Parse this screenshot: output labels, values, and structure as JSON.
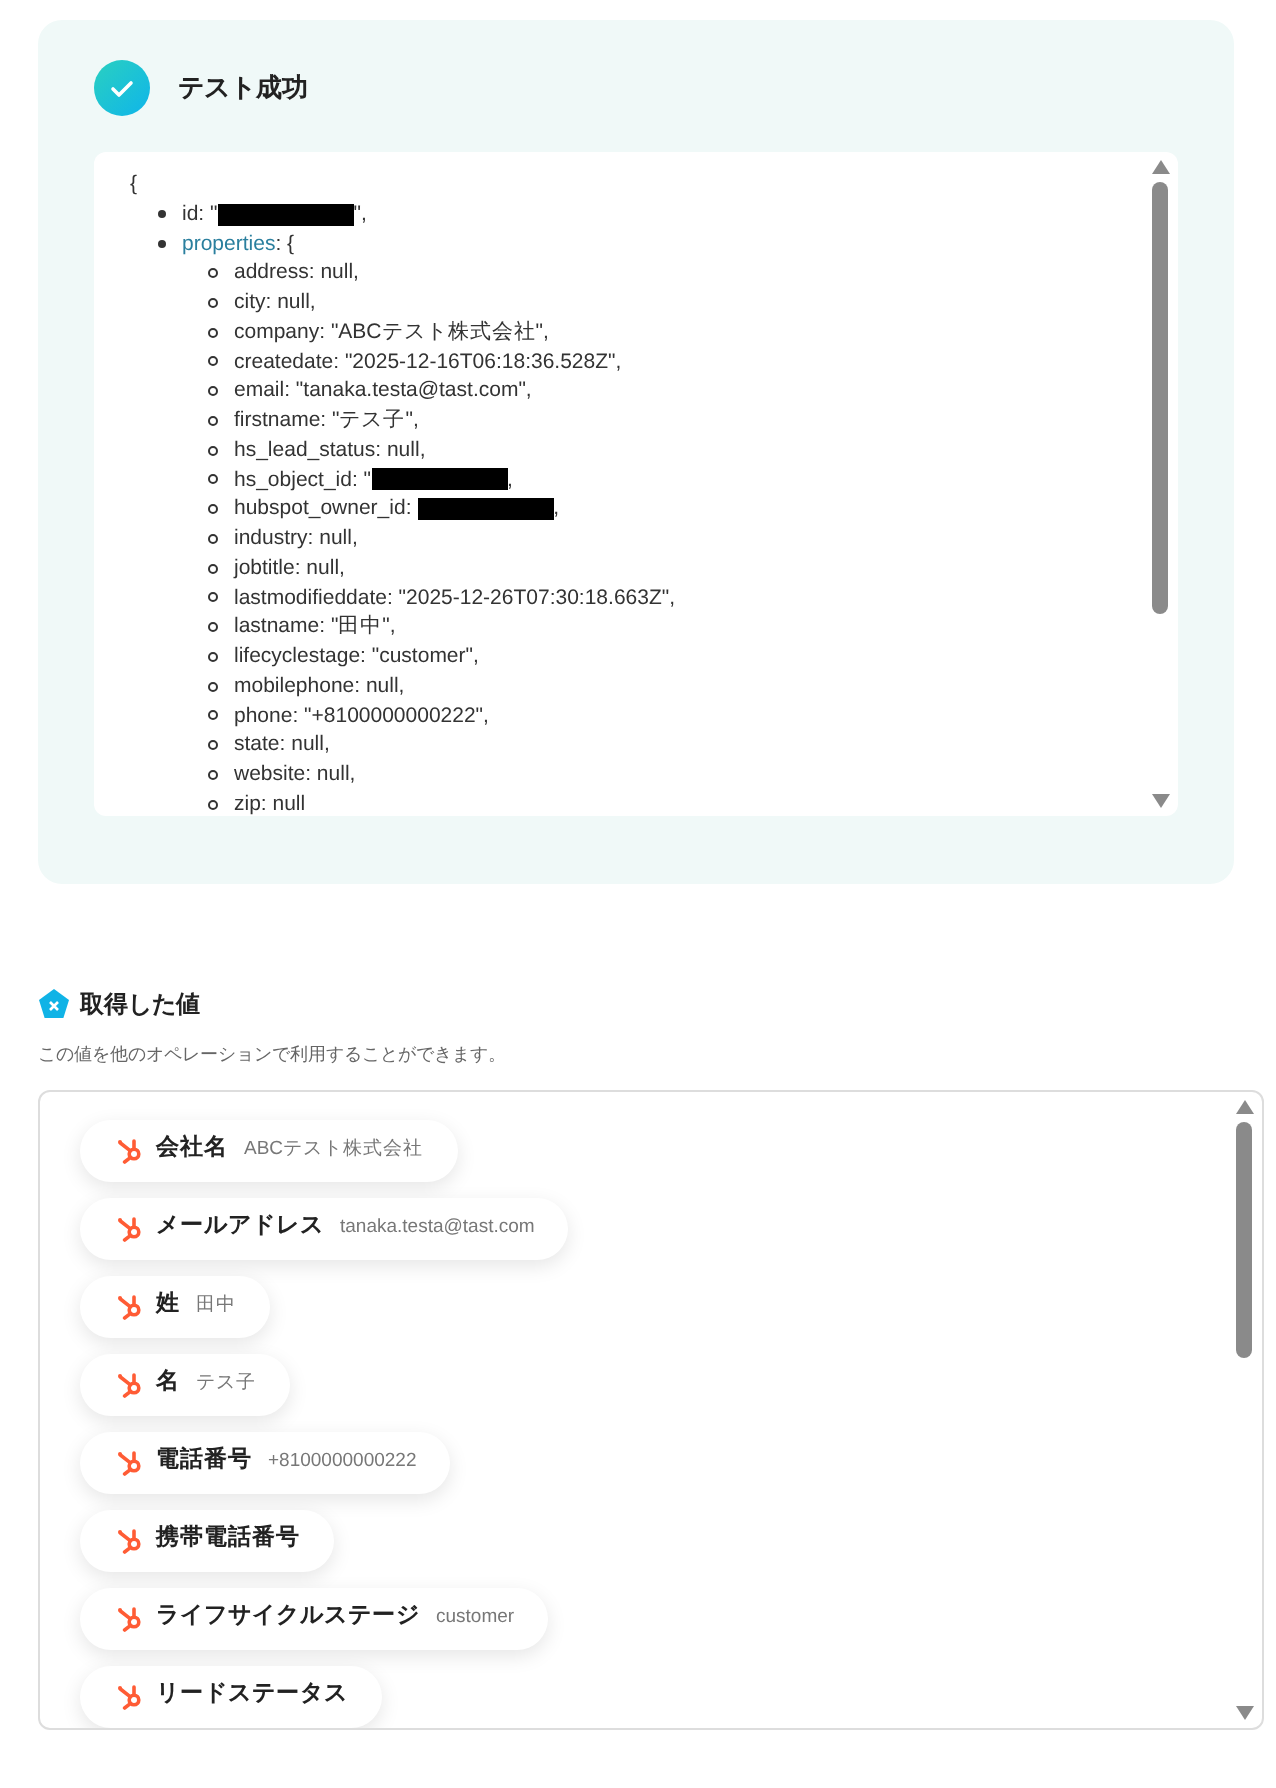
{
  "test_result": {
    "title": "テスト成功",
    "open": "{",
    "items": [
      {
        "kind": "field",
        "text": "id: \"",
        "redacted": true,
        "after": "\","
      },
      {
        "kind": "object",
        "key": "properties",
        "after": ": {",
        "children": [
          {
            "text": "address: null,",
            "redacted": false
          },
          {
            "text": "city: null,",
            "redacted": false
          },
          {
            "text": "company: \"ABCテスト株式会社\",",
            "redacted": false
          },
          {
            "text": "createdate: \"2025-12-16T06:18:36.528Z\",",
            "redacted": false
          },
          {
            "text": "email: \"tanaka.testa@tast.com\",",
            "redacted": false
          },
          {
            "text": "firstname: \"テス子\",",
            "redacted": false
          },
          {
            "text": "hs_lead_status: null,",
            "redacted": false
          },
          {
            "text": "hs_object_id: \"",
            "redacted": true,
            "after": ","
          },
          {
            "text": "hubspot_owner_id: ",
            "redacted": true,
            "after": ","
          },
          {
            "text": "industry: null,",
            "redacted": false
          },
          {
            "text": "jobtitle: null,",
            "redacted": false
          },
          {
            "text": "lastmodifieddate: \"2025-12-26T07:30:18.663Z\",",
            "redacted": false
          },
          {
            "text": "lastname: \"田中\",",
            "redacted": false
          },
          {
            "text": "lifecyclestage: \"customer\",",
            "redacted": false
          },
          {
            "text": "mobilephone: null,",
            "redacted": false
          },
          {
            "text": "phone: \"+8100000000222\",",
            "redacted": false
          },
          {
            "text": "state: null,",
            "redacted": false
          },
          {
            "text": "website: null,",
            "redacted": false
          },
          {
            "text": "zip: null",
            "redacted": false
          }
        ]
      }
    ]
  },
  "values": {
    "title": "取得した値",
    "description": "この値を他のオペレーションで利用することができます。",
    "items": [
      {
        "label": "会社名",
        "value": "ABCテスト株式会社"
      },
      {
        "label": "メールアドレス",
        "value": "tanaka.testa@tast.com"
      },
      {
        "label": "姓",
        "value": "田中"
      },
      {
        "label": "名",
        "value": "テス子"
      },
      {
        "label": "電話番号",
        "value": "+8100000000222"
      },
      {
        "label": "携帯電話番号"
      },
      {
        "label": "ライフサイクルステージ",
        "value": "customer"
      },
      {
        "label": "リードステータス"
      }
    ]
  }
}
